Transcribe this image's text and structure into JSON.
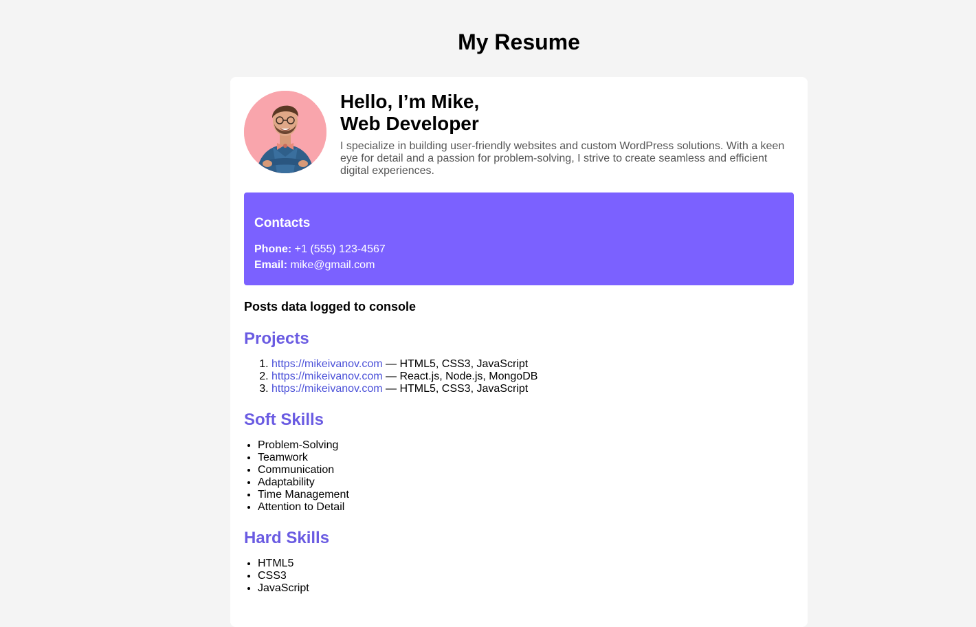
{
  "page": {
    "title": "My Resume"
  },
  "intro": {
    "greeting": "Hello, I’m Mike,",
    "role": "Web Developer",
    "description": "I specialize in building user-friendly websites and custom WordPress solutions. With a keen eye for detail and a passion for problem-solving, I strive to create seamless and efficient digital experiences."
  },
  "contacts": {
    "title": "Contacts",
    "phone_label": "Phone:",
    "phone": "+1 (555) 123-4567",
    "email_label": "Email:",
    "email": "mike@gmail.com"
  },
  "posts_note": "Posts data logged to console",
  "projects": {
    "title": "Projects",
    "items": [
      {
        "url": "https://mikeivanov.com",
        "stack": " — HTML5, CSS3, JavaScript"
      },
      {
        "url": "https://mikeivanov.com",
        "stack": " — React.js, Node.js, MongoDB"
      },
      {
        "url": "https://mikeivanov.com",
        "stack": " — HTML5, CSS3, JavaScript"
      }
    ]
  },
  "soft_skills": {
    "title": "Soft Skills",
    "items": [
      "Problem-Solving",
      "Teamwork",
      "Communication",
      "Adaptability",
      "Time Management",
      "Attention to Detail"
    ]
  },
  "hard_skills": {
    "title": "Hard Skills",
    "items": [
      "HTML5",
      "CSS3",
      "JavaScript"
    ]
  },
  "colors": {
    "page_background": "#f4f4f4",
    "card_background": "#ffffff",
    "contacts_background": "#7b61ff",
    "section_title": "#6a5be2",
    "link": "#4a50d8",
    "avatar_background": "#f9a5ac"
  }
}
